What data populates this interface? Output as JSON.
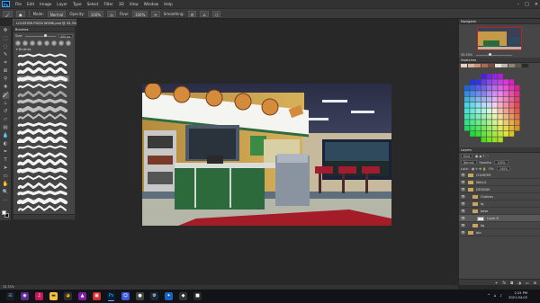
{
  "app": {
    "logo": "Ps"
  },
  "menu": [
    "File",
    "Edit",
    "Image",
    "Layer",
    "Type",
    "Select",
    "Filter",
    "3D",
    "View",
    "Window",
    "Help"
  ],
  "window_controls": [
    "–",
    "□",
    "✕"
  ],
  "options": {
    "mode_label": "Mode:",
    "mode_value": "Normal",
    "opacity_label": "Opacity:",
    "opacity_value": "100%",
    "flow_label": "Flow:",
    "flow_value": "100%",
    "smoothing_label": "Smoothing:"
  },
  "document": {
    "tab_title": "LOCATION PIZZA WORK.psd @ 33.3% (Layer 8, RGB/8#)",
    "close": "×"
  },
  "brushes_panel": {
    "title": "Brushes",
    "size_label": "Size:",
    "size_value": "400 px",
    "folder": "Brushes"
  },
  "navigator": {
    "title": "Navigator",
    "zoom": "33.33%"
  },
  "swatches": {
    "title": "Swatches",
    "colors": [
      "#e9d2c0",
      "#d9b49c",
      "#c78f73",
      "#a96b55",
      "#7a4a3d",
      "#e8e4d8",
      "#bfb7a8",
      "#8d8577",
      "#5d574d",
      "#2e2b27"
    ]
  },
  "layers": {
    "title": "Layers",
    "kind_label": "Kind",
    "blend_label": "Normal",
    "opacity_label": "Opacity:",
    "opacity_value": "100%",
    "lock_label": "Lock:",
    "fill_label": "Fill:",
    "fill_value": "100%",
    "items": [
      {
        "name": "COUNTER",
        "type": "folder",
        "indent": 0
      },
      {
        "name": "WALLS",
        "type": "folder",
        "indent": 0
      },
      {
        "name": "DESIGNS",
        "type": "folder",
        "indent": 0
      },
      {
        "name": "Outlines",
        "type": "folder",
        "indent": 1
      },
      {
        "name": "fg",
        "type": "folder",
        "indent": 1
      },
      {
        "name": "base",
        "type": "folder",
        "indent": 1
      },
      {
        "name": "Layer 8",
        "type": "layer",
        "indent": 2,
        "selected": true
      },
      {
        "name": "bg",
        "type": "folder",
        "indent": 1
      },
      {
        "name": "bkc",
        "type": "folder",
        "indent": 0
      }
    ]
  },
  "status": {
    "zoom": "33.33%"
  },
  "taskbar": {
    "time": "2:25 PM",
    "date": "2021-04-02"
  }
}
